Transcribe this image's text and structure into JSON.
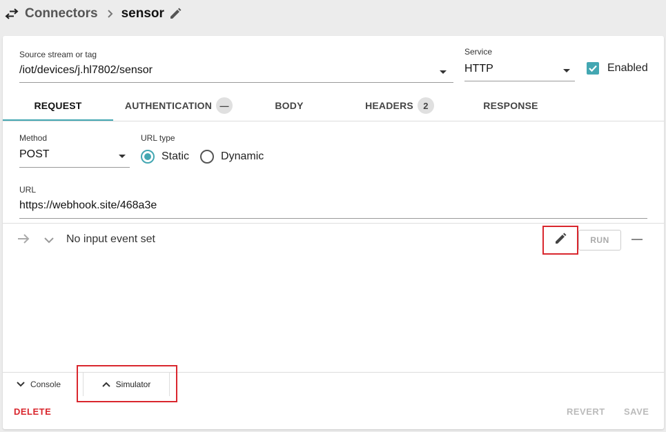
{
  "breadcrumb": {
    "swap_icon": "swap-horizontal-icon",
    "parent": "Connectors",
    "separator_icon": "chevron-right-icon",
    "current": "sensor",
    "edit_icon": "pencil-icon"
  },
  "form": {
    "source": {
      "label": "Source stream or tag",
      "value": "/iot/devices/j.hl7802/sensor"
    },
    "service": {
      "label": "Service",
      "value": "HTTP"
    },
    "enabled": {
      "label": "Enabled",
      "checked": true
    }
  },
  "tabs": [
    {
      "label": "REQUEST",
      "active": true
    },
    {
      "label": "AUTHENTICATION",
      "badge": "—"
    },
    {
      "label": "BODY"
    },
    {
      "label": "HEADERS",
      "badge": "2"
    },
    {
      "label": "RESPONSE"
    }
  ],
  "request": {
    "method": {
      "label": "Method",
      "value": "POST"
    },
    "url_type": {
      "label": "URL type",
      "options": [
        "Static",
        "Dynamic"
      ],
      "selected": "Static"
    },
    "url": {
      "label": "URL",
      "value": "https://webhook.site/468a3e"
    }
  },
  "simulator": {
    "input_text": "No input event set",
    "run_label": "RUN"
  },
  "bottom": {
    "console_label": "Console",
    "simulator_label": "Simulator",
    "delete_label": "DELETE",
    "revert_label": "REVERT",
    "save_label": "SAVE"
  },
  "colors": {
    "accent": "#43a7b2",
    "danger": "#d9262d",
    "disabled": "#bbbbbb"
  }
}
